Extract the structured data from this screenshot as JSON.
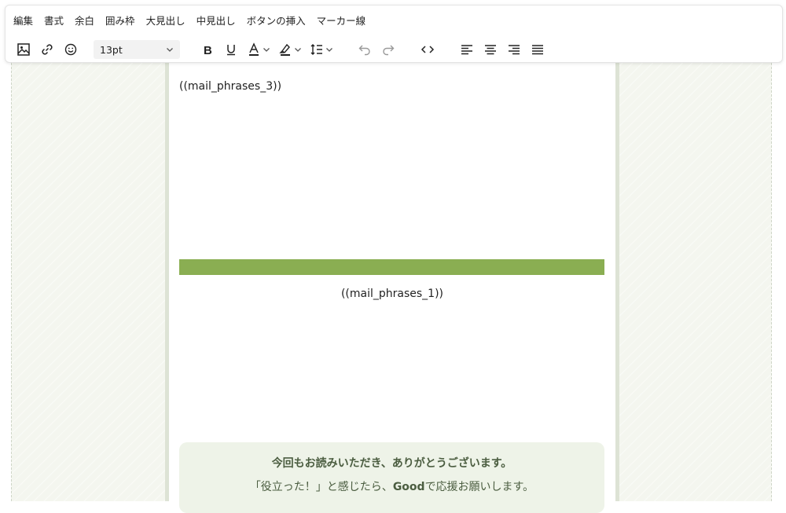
{
  "menubar": {
    "items": [
      "編集",
      "書式",
      "余白",
      "囲み枠",
      "大見出し",
      "中見出し",
      "ボタンの挿入",
      "マーカー線"
    ]
  },
  "toolbar": {
    "font_size": "13pt",
    "icons": [
      "image-icon",
      "link-icon",
      "emoji-icon",
      "bold-icon",
      "underline-icon",
      "text-color-icon",
      "highlight-icon",
      "line-height-icon",
      "undo-icon",
      "redo-icon",
      "code-icon",
      "align-left-icon",
      "align-center-icon",
      "align-right-icon",
      "align-justify-icon"
    ]
  },
  "mail": {
    "phrase_top": "((mail_phrases_3))",
    "phrase_middle": "((mail_phrases_1))",
    "thanks_line1": "今回もお読みいただき、ありがとうございます。",
    "thanks_line2_pre": "「役立った！」と感じたら、",
    "thanks_line2_bold": "Good",
    "thanks_line2_post": "で応援お願いします。"
  },
  "colors": {
    "accent_green": "#8aae52",
    "canvas_bg": "#f4f6ef",
    "thanks_bg": "#eef3e8",
    "thanks_text": "#4b5d40"
  }
}
